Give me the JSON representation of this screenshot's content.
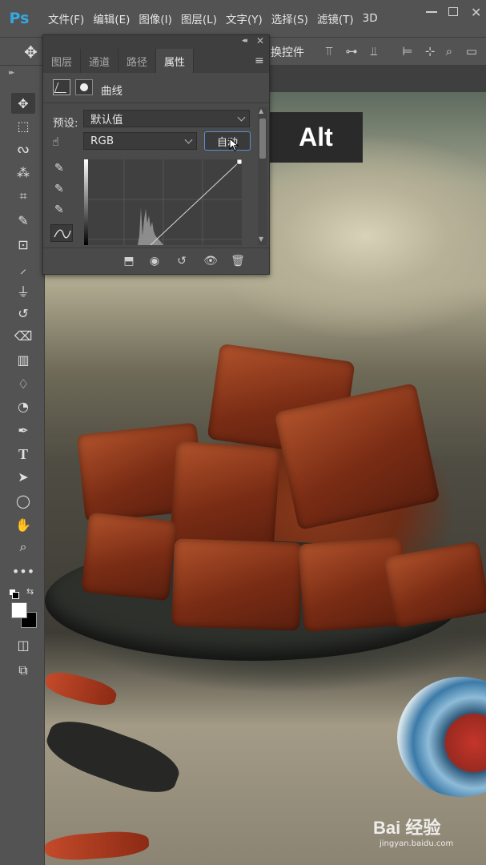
{
  "app": {
    "logo": "Ps"
  },
  "menu": {
    "items": [
      "文件(F)",
      "编辑(E)",
      "图像(I)",
      "图层(L)",
      "文字(Y)",
      "选择(S)",
      "滤镜(T)",
      "3D"
    ]
  },
  "options_bar": {
    "show_controls_text": "换控件"
  },
  "properties_panel": {
    "tabs": [
      "图层",
      "通道",
      "路径",
      "属性"
    ],
    "active_tab": "属性",
    "title": "曲线",
    "preset_label": "预设:",
    "preset_value": "默认值",
    "channel_value": "RGB",
    "auto_button": "自动"
  },
  "overlay": {
    "key_hint": "Alt"
  },
  "watermark": {
    "brand": "Bai 经验",
    "url": "jingyan.baidu.com"
  },
  "colors": {
    "ps_blue": "#35a8e0",
    "panel_bg": "#4a4a4a",
    "auto_button_border": "#5b8fd0",
    "foreground": "#ffffff",
    "background": "#000000"
  },
  "icons": {
    "toolbar": [
      "move-icon",
      "marquee-icon",
      "lasso-icon",
      "magic-wand-icon",
      "crop-icon",
      "eyedropper-icon",
      "patch-icon",
      "brush-icon",
      "stamp-icon",
      "history-brush-icon",
      "eraser-icon",
      "gradient-icon",
      "blur-icon",
      "dodge-icon",
      "pen-icon",
      "type-icon",
      "path-select-icon",
      "ellipse-icon",
      "hand-icon",
      "zoom-icon",
      "more-icon"
    ]
  }
}
